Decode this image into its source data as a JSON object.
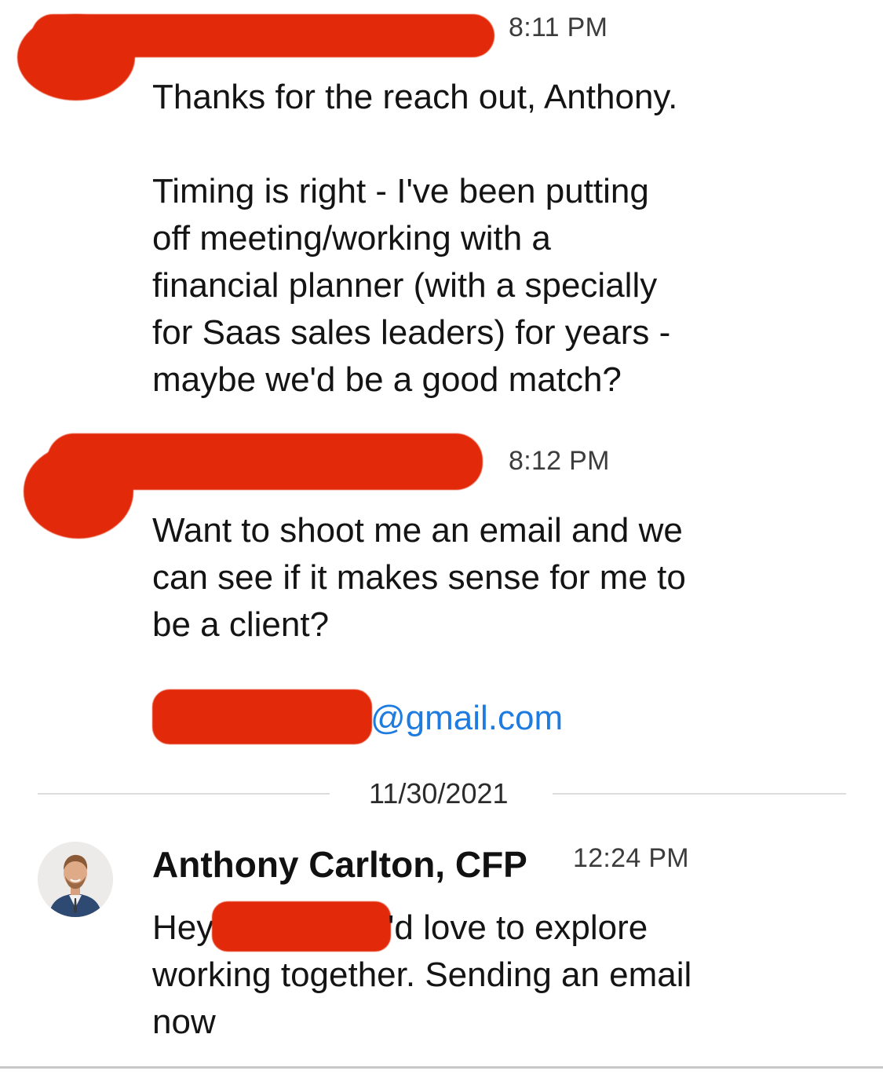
{
  "messages": [
    {
      "time": "8:11 PM",
      "text": "Thanks for the reach out, Anthony.\n\nTiming is right -  I've been putting\noff meeting/working with a\nfinancial planner (with a specially\nfor Saas sales leaders) for years -\nmaybe we'd be a good match?"
    },
    {
      "time": "8:12 PM",
      "text": "Want to shoot me an email and we\ncan see if it makes sense for me to\nbe a client?",
      "email_suffix": "@gmail.com"
    }
  ],
  "date_divider": "11/30/2021",
  "reply": {
    "sender": "Anthony Carlton, CFP",
    "time": "12:24 PM",
    "text_start": "Hey",
    "text_line1_end": "'d love to explore",
    "text_rest": "working together. Sending an email\nnow"
  },
  "colors": {
    "redaction": "#e22a0a",
    "link": "#1e7be0",
    "divider": "#dcdcdc"
  }
}
